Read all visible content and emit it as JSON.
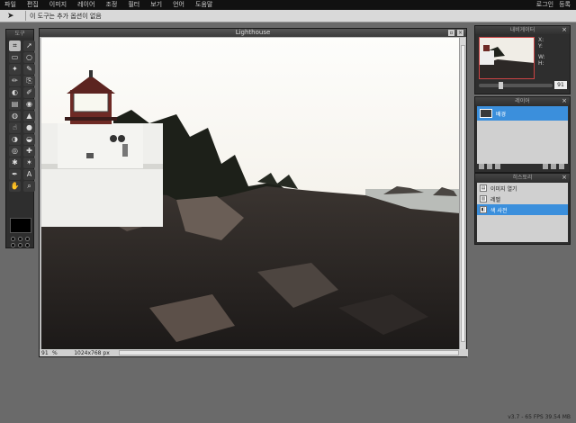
{
  "menubar": {
    "items": [
      "파일",
      "편집",
      "이미지",
      "레이어",
      "조정",
      "필터",
      "보기",
      "언어",
      "도움말"
    ],
    "right": [
      "로그인",
      "등록"
    ]
  },
  "optionbar": {
    "text": "이 도구는 추가 옵션이 없음"
  },
  "tools": {
    "title": "도구",
    "buttons": [
      "crop",
      "move",
      "marquee",
      "lasso",
      "wand",
      "pencil",
      "brush",
      "clone",
      "color-replace",
      "draw",
      "gradient",
      "paint-bucket",
      "blur",
      "sharpen",
      "smudge",
      "sponge",
      "dodge",
      "burn",
      "red-eye",
      "spot-heal",
      "bloat",
      "pinch",
      "text-color",
      "text",
      "hand",
      "zoom"
    ],
    "glyphs": [
      "⌗",
      "➚",
      "▭",
      "○",
      "✦",
      "✎",
      "✏",
      "⎘",
      "◐",
      "✐",
      "▤",
      "◉",
      "◍",
      "▲",
      "☝",
      "●",
      "◑",
      "◒",
      "◎",
      "✚",
      "✱",
      "✶",
      "✒",
      "A",
      "✋",
      "⌕"
    ],
    "foreground_color": "#000000"
  },
  "canvas": {
    "title": "Lighthouse",
    "zoom": "91",
    "zoom_unit": "%",
    "dimensions": "1024x768 px"
  },
  "navigator": {
    "title": "내비게이터",
    "x_label": "X:",
    "y_label": "Y:",
    "w_label": "W:",
    "h_label": "H:",
    "zoom": "91"
  },
  "layers": {
    "title": "레이어",
    "items": [
      {
        "name": "배경"
      }
    ]
  },
  "history": {
    "title": "히스토리",
    "items": [
      {
        "name": "이미지 열기"
      },
      {
        "name": "레벨"
      },
      {
        "name": "색 사전"
      }
    ],
    "selected_index": 2
  },
  "status": {
    "version": "v3.7 - 65 FPS 39.54 MB"
  },
  "colors": {
    "accent": "#3b8fdc",
    "panel": "#2e2e2e",
    "background": "#6a6a6a"
  }
}
